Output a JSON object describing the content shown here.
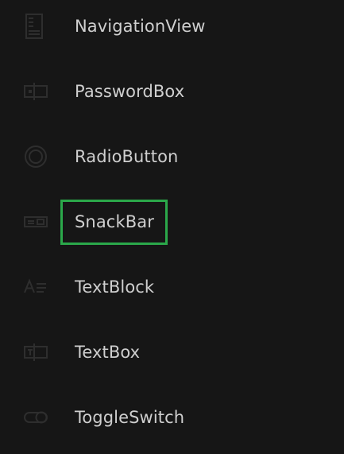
{
  "items": [
    {
      "label": "NavigationView",
      "icon": "navigation-view-icon"
    },
    {
      "label": "PasswordBox",
      "icon": "password-box-icon"
    },
    {
      "label": "RadioButton",
      "icon": "radio-button-icon"
    },
    {
      "label": "SnackBar",
      "icon": "snackbar-icon",
      "focused": true
    },
    {
      "label": "TextBlock",
      "icon": "text-block-icon"
    },
    {
      "label": "TextBox",
      "icon": "text-box-icon"
    },
    {
      "label": "ToggleSwitch",
      "icon": "toggle-switch-icon"
    }
  ],
  "colors": {
    "background": "#161616",
    "text": "#cfcfcf",
    "icon": "#2e2e2e",
    "focus": "#2ba84a"
  }
}
